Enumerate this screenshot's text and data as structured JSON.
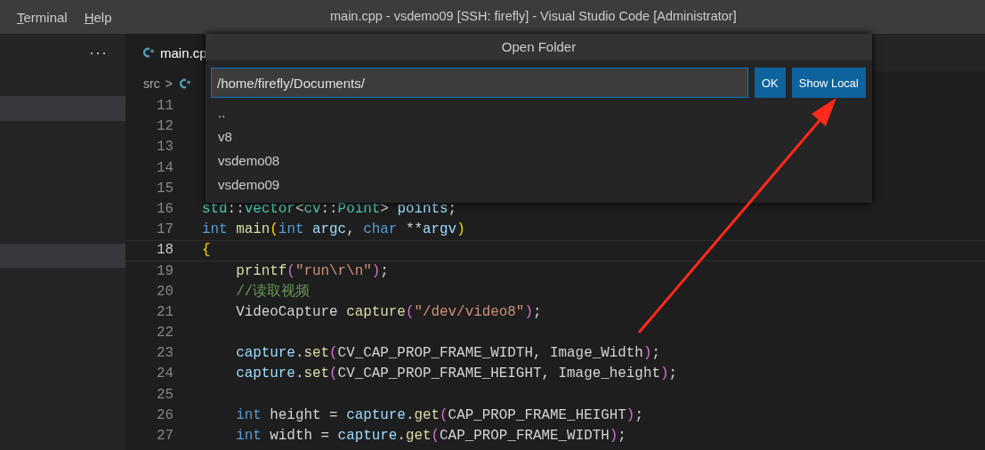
{
  "title_bar": {
    "menus": [
      {
        "label": "Terminal"
      },
      {
        "label": "Help"
      }
    ],
    "title": "main.cpp - vsdemo09 [SSH: firefly] - Visual Studio Code [Administrator]"
  },
  "sidebar": {
    "more": "···",
    "rows": [
      {
        "selected": true
      },
      {
        "selected": true
      }
    ]
  },
  "tabs": [
    {
      "label": "main.cp",
      "selected": true
    }
  ],
  "breadcrumb": {
    "folder": "src",
    "separator": ">"
  },
  "editor": {
    "lines": [
      {
        "number": "11",
        "current": false
      },
      {
        "number": "12",
        "current": false
      },
      {
        "number": "13",
        "current": false
      },
      {
        "number": "14",
        "current": false
      },
      {
        "number": "15",
        "current": false
      },
      {
        "number": "16",
        "current": false,
        "tokens": [
          {
            "text": "std",
            "kind": "type"
          },
          {
            "text": "::",
            "kind": "plain"
          },
          {
            "text": "vector",
            "kind": "type"
          },
          {
            "text": "<",
            "kind": "plain"
          },
          {
            "text": "cv",
            "kind": "type"
          },
          {
            "text": "::",
            "kind": "plain"
          },
          {
            "text": "Point",
            "kind": "type"
          },
          {
            "text": ">",
            "kind": "plain"
          },
          {
            "text": " points",
            "kind": "var"
          },
          {
            "text": ";",
            "kind": "plain"
          }
        ]
      },
      {
        "number": "17",
        "current": false,
        "tokens": [
          {
            "text": "int",
            "kind": "kw"
          },
          {
            "text": " main",
            "kind": "fn"
          },
          {
            "text": "(",
            "kind": "b1"
          },
          {
            "text": "int",
            "kind": "kw"
          },
          {
            "text": " argc",
            "kind": "var"
          },
          {
            "text": ",",
            "kind": "plain"
          },
          {
            "text": " char",
            "kind": "kw"
          },
          {
            "text": " **",
            "kind": "plain"
          },
          {
            "text": "argv",
            "kind": "var"
          },
          {
            "text": ")",
            "kind": "b1"
          }
        ]
      },
      {
        "number": "18",
        "current": true,
        "tokens": [
          {
            "text": "{",
            "kind": "b1"
          }
        ]
      },
      {
        "number": "19",
        "current": false,
        "tokens": [
          {
            "text": "    printf",
            "kind": "fn"
          },
          {
            "text": "(",
            "kind": "b2"
          },
          {
            "text": "\"run\\r\\n\"",
            "kind": "str"
          },
          {
            "text": ")",
            "kind": "b2"
          },
          {
            "text": ";",
            "kind": "plain"
          }
        ]
      },
      {
        "number": "20",
        "current": false,
        "tokens": [
          {
            "text": "    //读取视频",
            "kind": "cmt"
          }
        ]
      },
      {
        "number": "21",
        "current": false,
        "tokens": [
          {
            "text": "    VideoCapture ",
            "kind": "plain"
          },
          {
            "text": "capture",
            "kind": "fn"
          },
          {
            "text": "(",
            "kind": "b2"
          },
          {
            "text": "\"/dev/video8\"",
            "kind": "str"
          },
          {
            "text": ")",
            "kind": "b2"
          },
          {
            "text": ";",
            "kind": "plain"
          }
        ]
      },
      {
        "number": "22",
        "current": false
      },
      {
        "number": "23",
        "current": false,
        "tokens": [
          {
            "text": "    capture",
            "kind": "var"
          },
          {
            "text": ".",
            "kind": "plain"
          },
          {
            "text": "set",
            "kind": "fn"
          },
          {
            "text": "(",
            "kind": "b2"
          },
          {
            "text": "CV_CAP_PROP_FRAME_WIDTH, Image_Width",
            "kind": "plain"
          },
          {
            "text": ")",
            "kind": "b2"
          },
          {
            "text": ";",
            "kind": "plain"
          }
        ]
      },
      {
        "number": "24",
        "current": false,
        "tokens": [
          {
            "text": "    capture",
            "kind": "var"
          },
          {
            "text": ".",
            "kind": "plain"
          },
          {
            "text": "set",
            "kind": "fn"
          },
          {
            "text": "(",
            "kind": "b2"
          },
          {
            "text": "CV_CAP_PROP_FRAME_HEIGHT, Image_height",
            "kind": "plain"
          },
          {
            "text": ")",
            "kind": "b2"
          },
          {
            "text": ";",
            "kind": "plain"
          }
        ]
      },
      {
        "number": "25",
        "current": false
      },
      {
        "number": "26",
        "current": false,
        "tokens": [
          {
            "text": "    int",
            "kind": "kw"
          },
          {
            "text": " height = ",
            "kind": "plain"
          },
          {
            "text": "capture",
            "kind": "var"
          },
          {
            "text": ".",
            "kind": "plain"
          },
          {
            "text": "get",
            "kind": "fn"
          },
          {
            "text": "(",
            "kind": "b2"
          },
          {
            "text": "CAP_PROP_FRAME_HEIGHT",
            "kind": "plain"
          },
          {
            "text": ")",
            "kind": "b2"
          },
          {
            "text": ";",
            "kind": "plain"
          }
        ]
      },
      {
        "number": "27",
        "current": false,
        "tokens": [
          {
            "text": "    int",
            "kind": "kw"
          },
          {
            "text": " width = ",
            "kind": "plain"
          },
          {
            "text": "capture",
            "kind": "var"
          },
          {
            "text": ".",
            "kind": "plain"
          },
          {
            "text": "get",
            "kind": "fn"
          },
          {
            "text": "(",
            "kind": "b2"
          },
          {
            "text": "CAP_PROP_FRAME_WIDTH",
            "kind": "plain"
          },
          {
            "text": ")",
            "kind": "b2"
          },
          {
            "text": ";",
            "kind": "plain"
          }
        ]
      }
    ]
  },
  "dialog": {
    "title": "Open Folder",
    "path_field": {
      "value": "/home/firefly/Documents/"
    },
    "buttons": [
      {
        "label": "OK"
      },
      {
        "label": "Show Local"
      }
    ],
    "items": [
      {
        "label": ".."
      },
      {
        "label": "v8"
      },
      {
        "label": "vsdemo08"
      },
      {
        "label": "vsdemo09"
      }
    ]
  }
}
